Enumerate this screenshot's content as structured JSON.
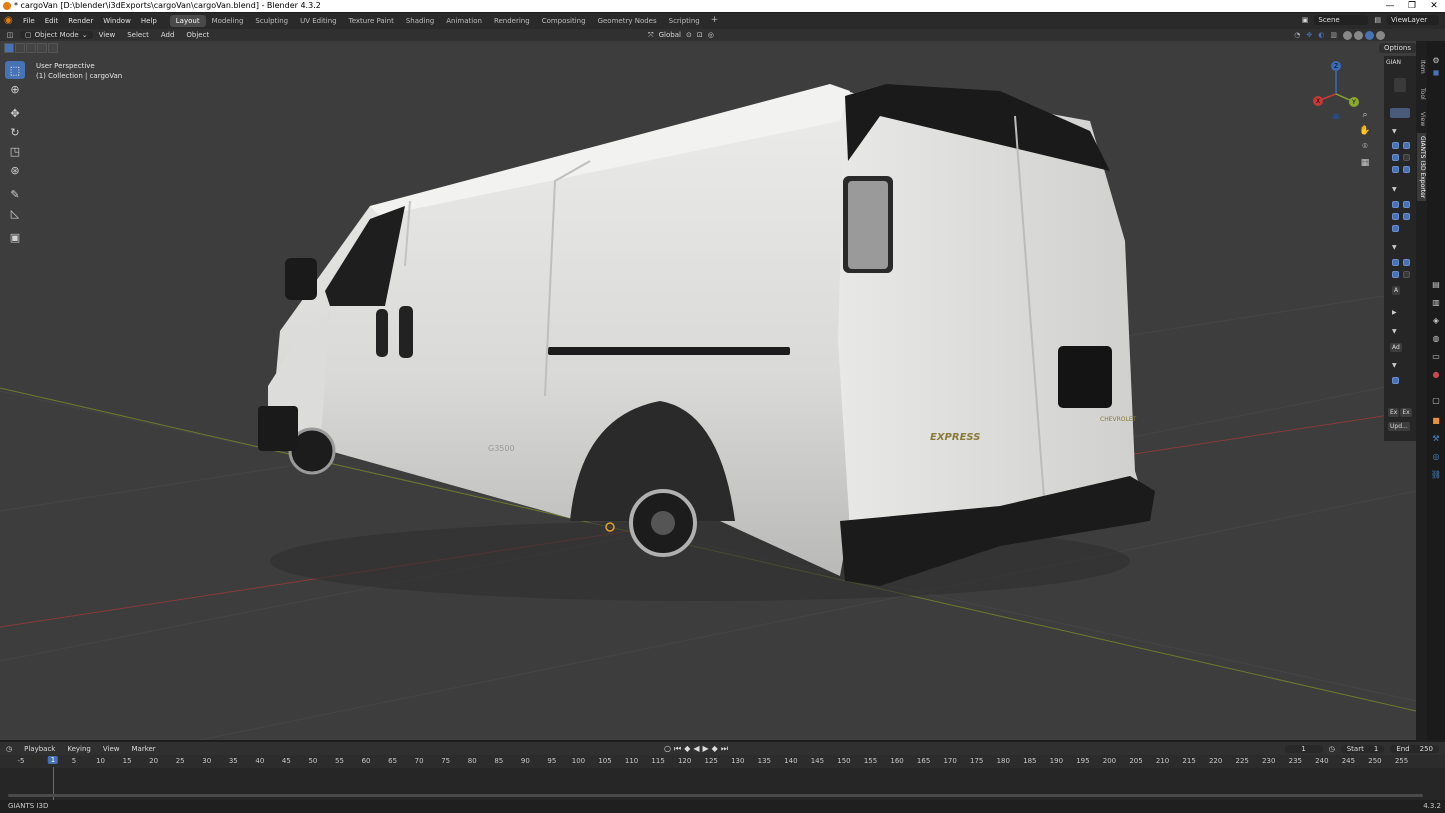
{
  "window": {
    "title": "* cargoVan [D:\\blender\\i3dExports\\cargoVan\\cargoVan.blend] - Blender 4.3.2",
    "min": "—",
    "max": "❐",
    "close": "✕"
  },
  "menu": {
    "items": [
      "File",
      "Edit",
      "Render",
      "Window",
      "Help"
    ],
    "workspaces": [
      "Layout",
      "Modeling",
      "Sculpting",
      "UV Editing",
      "Texture Paint",
      "Shading",
      "Animation",
      "Rendering",
      "Compositing",
      "Geometry Nodes",
      "Scripting"
    ],
    "active_workspace": "Layout",
    "add": "+",
    "scene": "Scene",
    "view_layer": "ViewLayer"
  },
  "viewport_header": {
    "mode": "Object Mode",
    "menus": [
      "View",
      "Select",
      "Add",
      "Object"
    ],
    "transform_orientation": "Global",
    "options": "Options"
  },
  "viewport": {
    "perspective": "User Perspective",
    "collection": "(1) Collection | cargoVan",
    "van_badge_side": "G3500",
    "van_badge_rear": "EXPRESS",
    "van_badge_brand": "CHEVROLET"
  },
  "gizmo": {
    "z": "Z",
    "y": "Y",
    "x": "X"
  },
  "npanel": {
    "header": "GIAN",
    "a_label": "A",
    "add_label": "Ad",
    "ex1": "Ex",
    "ex2": "Ex",
    "update": "Upd..."
  },
  "sidetabs": [
    "Item",
    "Tool",
    "View",
    "GIANTS I3D Exporter"
  ],
  "timeline": {
    "menus": [
      "Playback",
      "Keying",
      "View",
      "Marker"
    ],
    "current_frame": "1",
    "start_label": "Start",
    "start": "1",
    "end_label": "End",
    "end": "250",
    "ticks": [
      "-5",
      "1",
      "5",
      "10",
      "15",
      "20",
      "25",
      "30",
      "35",
      "40",
      "45",
      "50",
      "55",
      "60",
      "65",
      "70",
      "75",
      "80",
      "85",
      "90",
      "95",
      "100",
      "105",
      "110",
      "115",
      "120",
      "125",
      "130",
      "135",
      "140",
      "145",
      "150",
      "155",
      "160",
      "165",
      "170",
      "175",
      "180",
      "185",
      "190",
      "195",
      "200",
      "205",
      "210",
      "215",
      "220",
      "225",
      "230",
      "235",
      "240",
      "245",
      "250",
      "255"
    ]
  },
  "status": {
    "left": "GIANTS I3D",
    "version": "4.3.2"
  },
  "colors": {
    "accent": "#4772b3",
    "viewport_bg": "#3d3d3d",
    "axis_x": "#a03c3c",
    "axis_y": "#8a9a3a"
  }
}
